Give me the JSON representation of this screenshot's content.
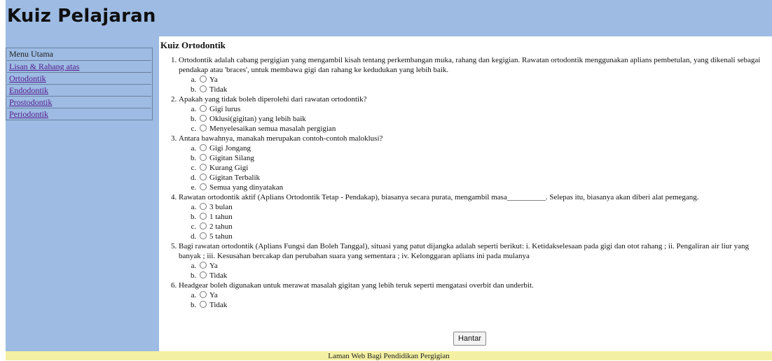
{
  "header": {
    "title": "Kuiz Pelajaran"
  },
  "sidebar": {
    "menu_title": "Menu Utama",
    "items": [
      {
        "label": "Lisan & Rahang atas"
      },
      {
        "label": "Ortodontik"
      },
      {
        "label": "Endodontik"
      },
      {
        "label": "Prostodontik"
      },
      {
        "label": "Periodontik"
      }
    ]
  },
  "main": {
    "title": "Kuiz Ortodontik",
    "questions": [
      {
        "text": "Ortodontik adalah cabang pergigian yang mengambil kisah tentang perkembangan muka, rahang dan kegigian. Rawatan ortodontik menggunakan aplians pembetulan, yang dikenali sebagai pendakap atau 'braces', untuk membawa gigi dan rahang ke kedudukan yang lebih baik.",
        "options": [
          "Ya",
          "Tidak"
        ]
      },
      {
        "text": "Apakah yang tidak boleh diperolehi dari rawatan ortodontik?",
        "options": [
          "Gigi lurus",
          "Oklusi(gigitan) yang lebih baik",
          "Menyelesaikan semua masalah pergigian"
        ]
      },
      {
        "text": "Antara bawahnya, manakah merupakan contoh-contoh maloklusi?",
        "options": [
          "Gigi Jongang",
          "Gigitan Silang",
          "Kurang Gigi",
          "Gigitan Terbalik",
          "Semua yang dinyatakan"
        ]
      },
      {
        "text": "Rawatan ortodontik aktif (Aplians Ortodontik Tetap - Pendakap), biasanya secara purata, mengambil masa__________. Selepas itu, biasanya akan diberi alat pemegang.",
        "options": [
          "3 bulan",
          "1 tahun",
          "2 tahun",
          "5 tahun"
        ]
      },
      {
        "text": "Bagi rawatan ortodontik (Aplians Fungsi dan Boleh Tanggal), situasi yang patut dijangka adalah seperti berikut: i. Ketidakselesaan pada gigi dan otot rahang ; ii. Pengaliran air liur yang banyak ; iii. Kesusahan bercakap dan perubahan suara yang sementara ; iv. Kelonggaran aplians ini pada mulanya",
        "options": [
          "Ya",
          "Tidak"
        ]
      },
      {
        "text": "Headgear boleh digunakan untuk merawat masalah gigitan yang lebih teruk seperti mengatasi overbit dan underbit.",
        "options": [
          "Ya",
          "Tidak"
        ]
      }
    ],
    "submit_label": "Hantar"
  },
  "footer": {
    "text": "Laman Web Bagi Pendidikan Pergigian"
  },
  "colors": {
    "header_bg": "#9dbbe3",
    "footer_bg": "#f4f0a3",
    "link": "#551a8b"
  }
}
